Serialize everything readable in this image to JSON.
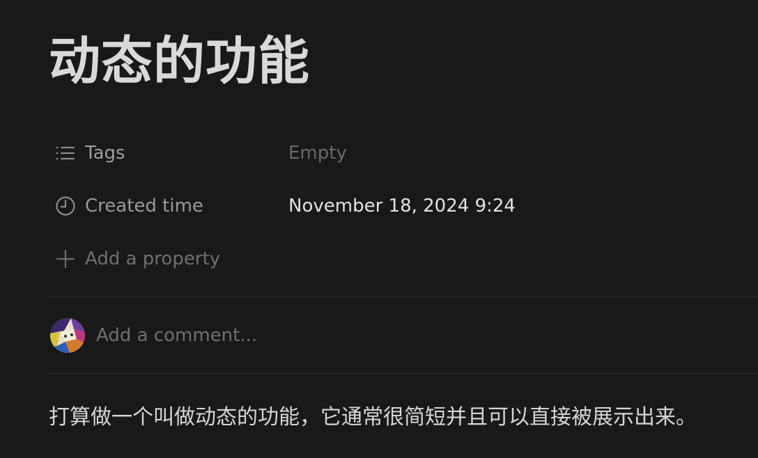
{
  "page": {
    "title": "动态的功能",
    "body_text": "打算做一个叫做动态的功能，它通常很简短并且可以直接被展示出来。"
  },
  "properties": [
    {
      "icon": "list-icon",
      "label": "Tags",
      "value": "Empty",
      "value_state": "empty"
    },
    {
      "icon": "clock-icon",
      "label": "Created time",
      "value": "November 18, 2024 9:24",
      "value_state": "filled"
    }
  ],
  "add_property": {
    "icon": "plus-icon",
    "label": "Add a property"
  },
  "comment": {
    "placeholder": "Add a comment..."
  },
  "colors": {
    "background": "#191919",
    "title": "#d9d9d9",
    "muted_text": "#8c8c8c",
    "placeholder_text": "#6f6f6f",
    "divider": "#2f2f2f"
  }
}
